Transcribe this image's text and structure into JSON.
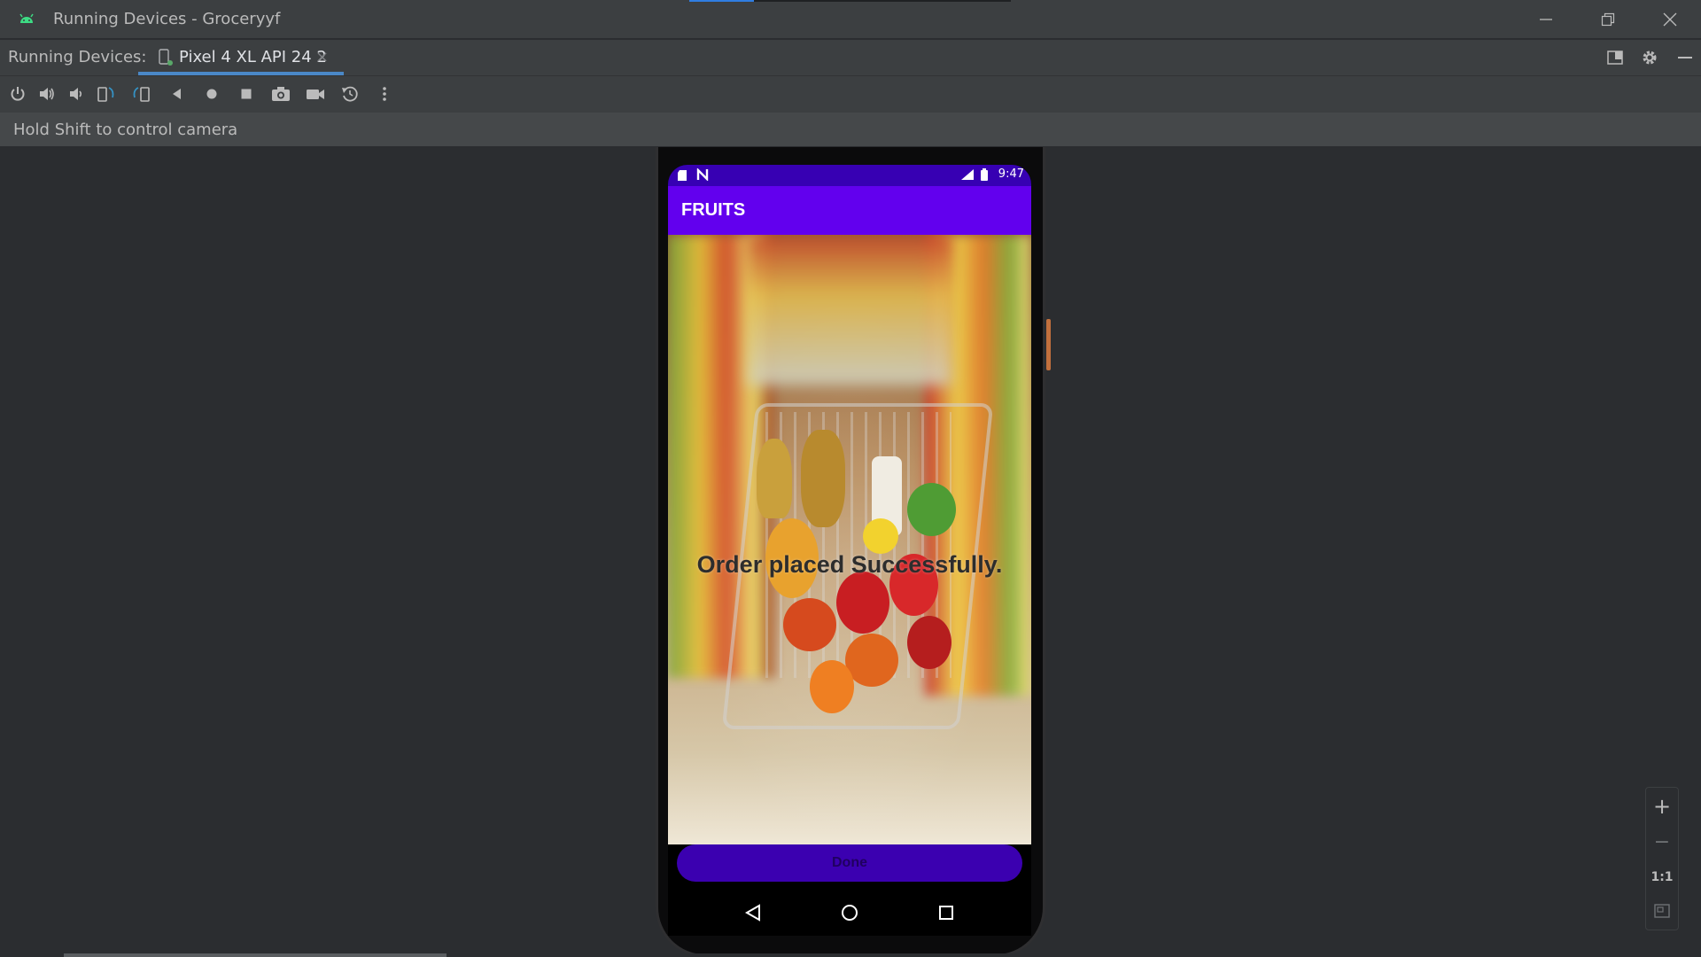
{
  "window": {
    "title": "Running Devices - Groceryyf",
    "icon": "android-icon",
    "controls": [
      "minimize-icon",
      "restore-icon",
      "close-icon"
    ]
  },
  "tabs": {
    "label": "Running Devices:",
    "device_tab": "Pixel 4 XL API 24 2",
    "close_glyph": "×",
    "right_icons": [
      "layout-icon",
      "settings-icon",
      "hide-icon"
    ]
  },
  "toolbar": {
    "items": [
      "power-icon",
      "volume-up-icon",
      "volume-down-icon",
      "rotate-left-icon",
      "rotate-right-icon",
      "back-icon",
      "home-icon",
      "overview-icon",
      "screenshot-icon",
      "screen-record-icon",
      "reset-icon",
      "more-icon"
    ]
  },
  "hint": "Hold Shift to control camera",
  "phone": {
    "status_time": "9:47",
    "app_title": "FRUITS",
    "message": "Order placed Successfully.",
    "done_label": "Done",
    "nav_icons": [
      "nav-back-icon",
      "nav-home-icon",
      "nav-recents-icon"
    ]
  },
  "zoom": {
    "zoom_in": "+",
    "zoom_out": "−",
    "actual_size": "1:1",
    "fit_icon": "fit-screen-icon"
  },
  "colors": {
    "ide_bg": "#2b2d30",
    "status_bar": "#3700b3",
    "app_bar": "#6200ee",
    "done_button": "#3b00b0",
    "accent": "#4a88c7"
  }
}
